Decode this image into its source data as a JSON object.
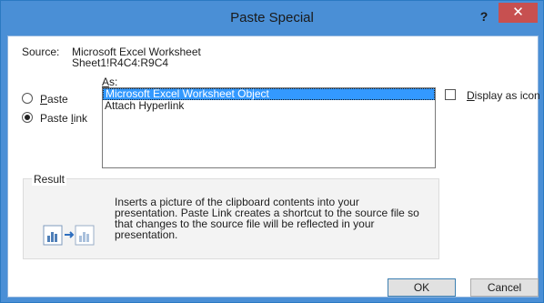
{
  "window": {
    "title": "Paste Special",
    "help": "?",
    "close": "✕"
  },
  "source": {
    "label": "Source:",
    "name": "Microsoft Excel Worksheet",
    "range": "Sheet1!R4C4:R9C4"
  },
  "as": {
    "prefix": "",
    "accel": "A",
    "rest": "s:"
  },
  "options": [
    {
      "pre": "",
      "accel": "P",
      "post": "aste",
      "selected": false
    },
    {
      "pre": "Paste ",
      "accel": "l",
      "post": "ink",
      "selected": true
    }
  ],
  "list": {
    "items": [
      "Microsoft Excel Worksheet Object",
      "Attach Hyperlink"
    ],
    "selected_index": 0
  },
  "display_as_icon": {
    "accel": "D",
    "rest": "isplay as icon",
    "checked": false
  },
  "result": {
    "caption": "Result",
    "lines": [
      "Inserts a picture of the clipboard contents into your",
      "presentation. Paste Link creates a shortcut to the source file so",
      "that changes to the source file will be reflected in your",
      "presentation."
    ]
  },
  "buttons": {
    "ok": "OK",
    "cancel": "Cancel"
  },
  "colors": {
    "titlebar": "#4a8fd6",
    "close": "#c75050",
    "selection": "#3399ff"
  }
}
